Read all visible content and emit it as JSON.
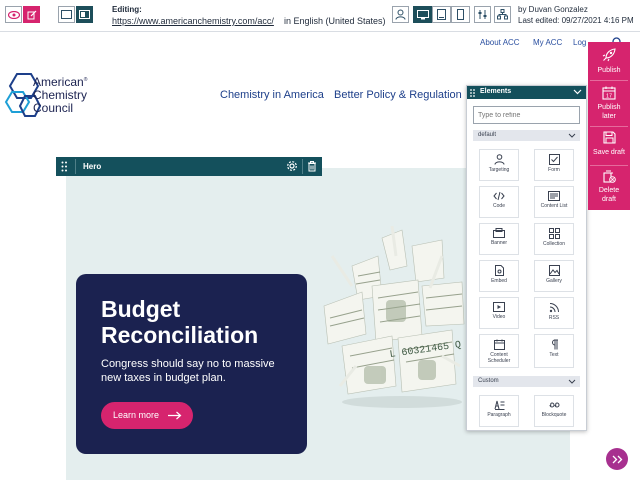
{
  "toolbar": {
    "editing_label": "Editing:",
    "url": "https://www.americanchemistry.com/acc/",
    "language": "in English (United States)",
    "author": "by Duvan Gonzalez",
    "last_edited": "Last edited: 09/27/2021 4:16 PM"
  },
  "site": {
    "logo_line1": "American",
    "logo_line2": "Chemistry",
    "logo_line3": "Council",
    "logo_reg": "®",
    "utility_nav": [
      "About ACC",
      "My ACC",
      "Log"
    ],
    "main_nav": [
      "Chemistry in America",
      "Better Policy & Regulation"
    ]
  },
  "hero": {
    "bar_label": "Hero",
    "title_line1": "Budget",
    "title_line2": "Reconciliation",
    "subtitle_line1": "Congress should say no to massive",
    "subtitle_line2": "new taxes in budget plan.",
    "button_label": "Learn more",
    "bill_serial": "L 60321465 Q"
  },
  "elements_panel": {
    "title": "Elements",
    "search_placeholder": "Type to refine",
    "section_default": "default",
    "section_custom": "Custom",
    "default_items": [
      "Targeting",
      "Form",
      "Code",
      "Content List",
      "Banner",
      "Collection",
      "Embed",
      "Gallery",
      "Video",
      "RSS",
      "Content Scheduler",
      "Text"
    ],
    "custom_items": [
      "Paragraph",
      "Blockquote"
    ]
  },
  "actions": {
    "publish": "Publish",
    "publish_later_1": "Publish",
    "publish_later_2": "later",
    "save_draft": "Save draft",
    "delete_draft_1": "Delete",
    "delete_draft_2": "draft",
    "calendar_day": "17"
  },
  "colors": {
    "accent_pink": "#d6246e",
    "toolbar_teal": "#14505c",
    "hero_card_navy": "#1b2250",
    "link_blue": "#1d3f8a"
  }
}
